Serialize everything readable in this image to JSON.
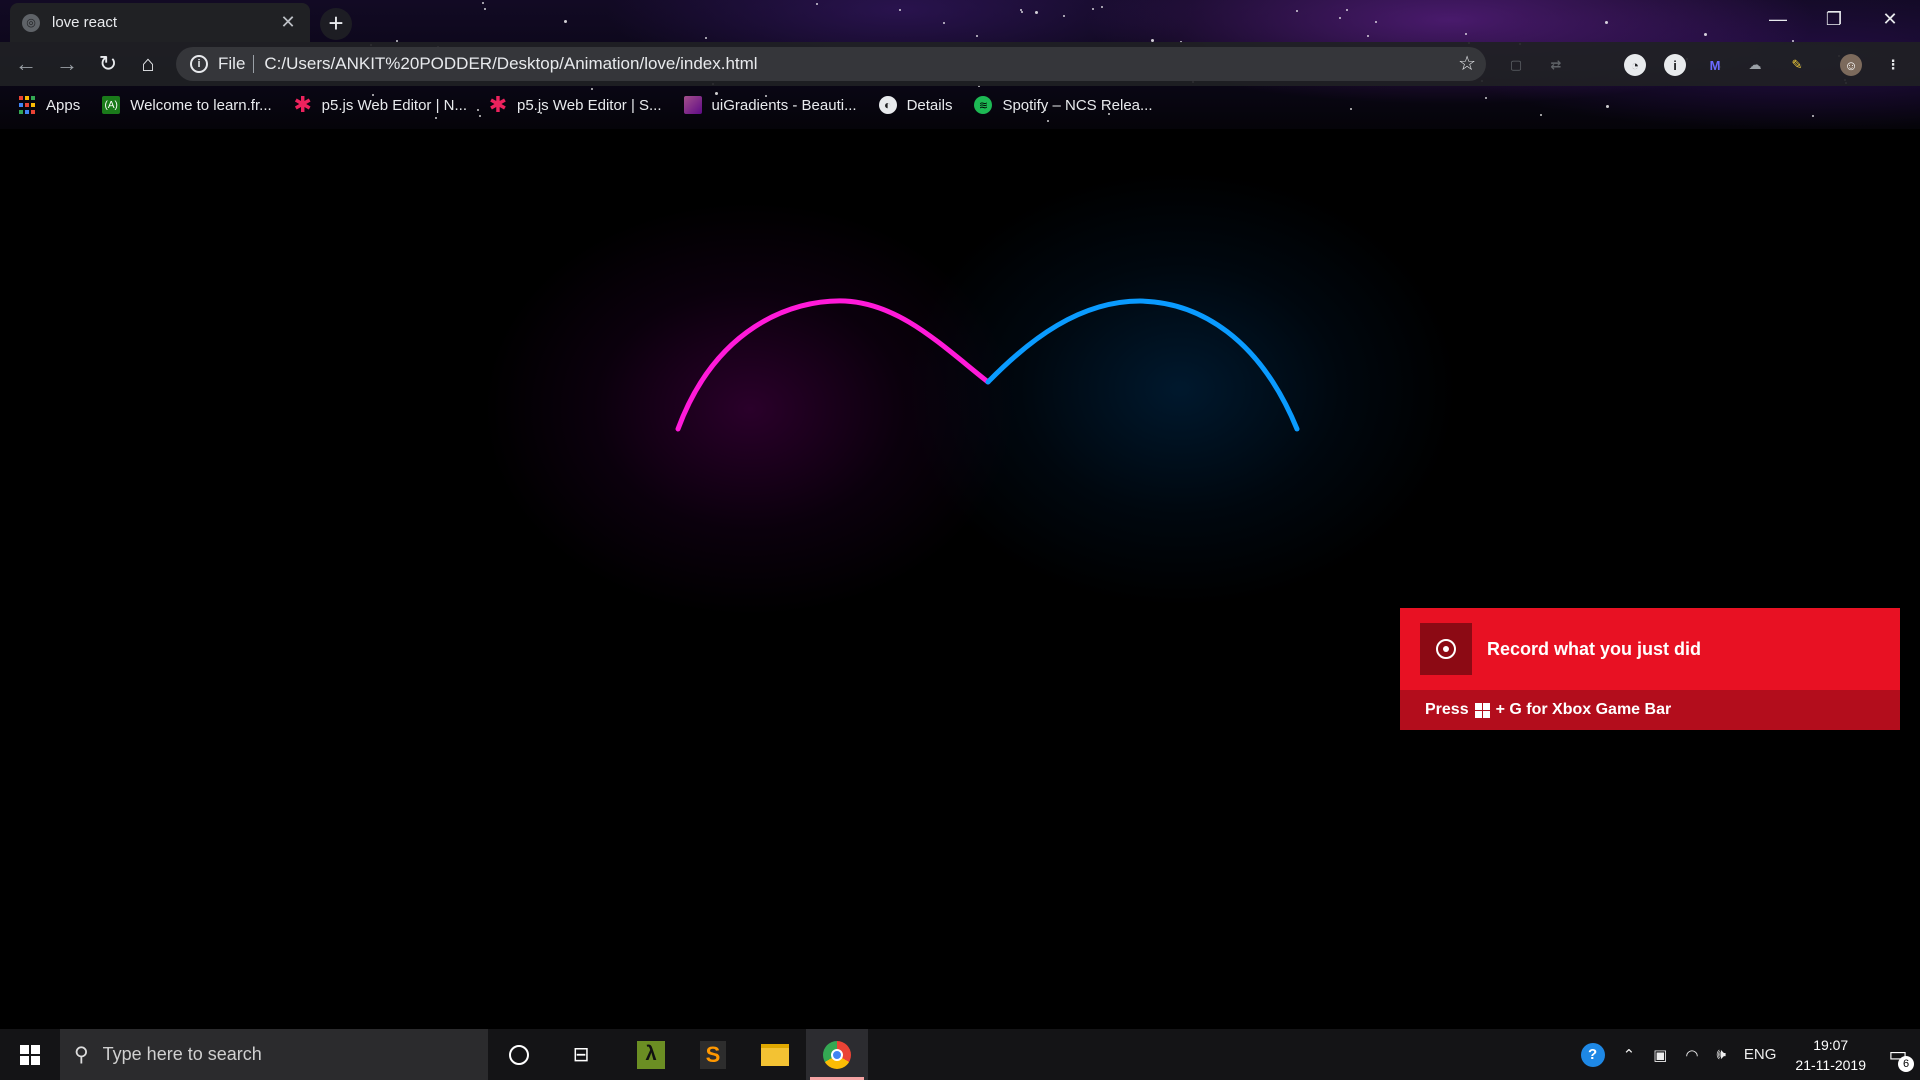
{
  "browser": {
    "tab": {
      "title": "love react"
    },
    "address_bar": {
      "scheme_label": "File",
      "url": "C:/Users/ANKIT%20PODDER/Desktop/Animation/love/index.html"
    },
    "bookmarks": [
      {
        "label": "Apps",
        "icon": "apps-grid-icon"
      },
      {
        "label": "Welcome to learn.fr...",
        "icon": "freecodecamp-icon"
      },
      {
        "label": "p5.js Web Editor | N...",
        "icon": "p5js-icon"
      },
      {
        "label": "p5.js Web Editor | S...",
        "icon": "p5js-icon"
      },
      {
        "label": "uiGradients - Beauti...",
        "icon": "uigradients-icon"
      },
      {
        "label": "Details",
        "icon": "globe-icon"
      },
      {
        "label": "Spotify – NCS Relea...",
        "icon": "spotify-icon"
      }
    ]
  },
  "page": {
    "heart_colors": {
      "left": "#ff1ad9",
      "right": "#0a9bff"
    }
  },
  "toast": {
    "headline": "Record what you just did",
    "hint_prefix": "Press",
    "hint_suffix": "+ G for Xbox Game Bar",
    "colors": {
      "top": "#e81123",
      "bottom": "#b30d1c"
    }
  },
  "taskbar": {
    "search_placeholder": "Type here to search",
    "language": "ENG",
    "time": "19:07",
    "date": "21-11-2019",
    "notification_count": "6"
  }
}
